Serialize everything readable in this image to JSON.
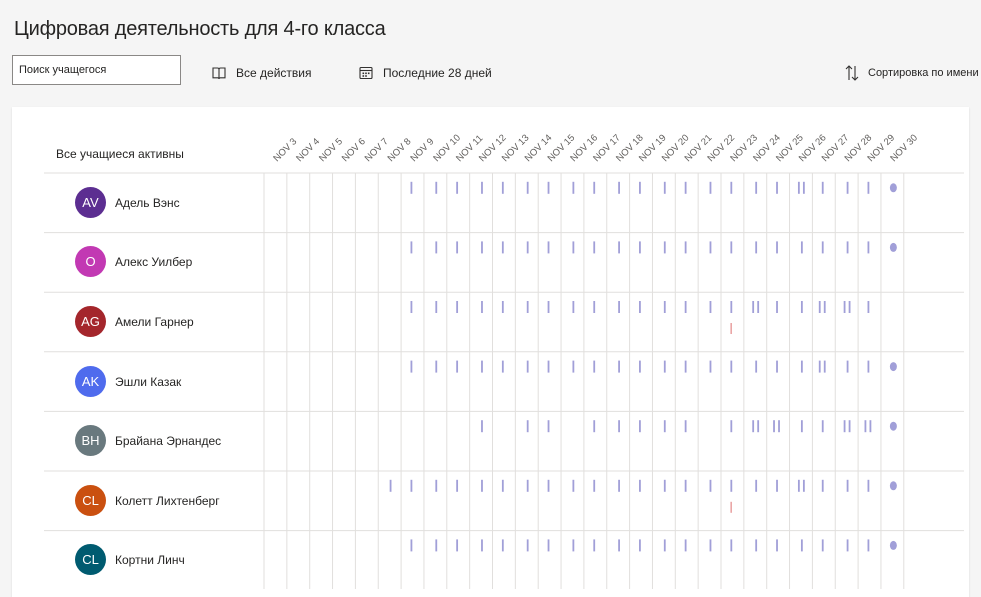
{
  "page_title": "Цифровая деятельность для 4-го класса",
  "search": {
    "placeholder": "Поиск учащегося"
  },
  "toolbar": {
    "activities_label": "Все действия",
    "activities_icon": "book-icon",
    "period_label": "Последние 28 дней",
    "period_icon": "calendar-icon",
    "sort_label": "Сортировка по имени",
    "sort_icon": "sort-icon"
  },
  "table": {
    "header_label": "Все учащиеся активны",
    "dates": [
      "NOV 3",
      "NOV 4",
      "NOV 5",
      "NOV 6",
      "NOV 7",
      "NOV 8",
      "NOV 9",
      "NOV 10",
      "NOV 11",
      "NOV 12",
      "NOV 13",
      "NOV 14",
      "NOV 15",
      "NOV 16",
      "NOV 17",
      "NOV 18",
      "NOV 19",
      "NOV 20",
      "NOV 21",
      "NOV 22",
      "NOV 23",
      "NOV 24",
      "NOV 25",
      "NOV 26",
      "NOV 27",
      "NOV 28",
      "NOV 29",
      "NOV 30"
    ]
  },
  "colors": {
    "activity": "#a19fd8",
    "alert": "#e8a0a0",
    "grid": "#e1dfdd"
  },
  "students": [
    {
      "name": "Адель Вэнс",
      "initials": "AV",
      "color": "#5c2e91",
      "activity": [
        0,
        0,
        0,
        0,
        0,
        0,
        1,
        1,
        1,
        1,
        1,
        1,
        1,
        1,
        1,
        1,
        1,
        1,
        1,
        1,
        1,
        1,
        1,
        2,
        1,
        1,
        1,
        3
      ]
    },
    {
      "name": "Алекс Уилбер",
      "initials": "О",
      "color": "#c239b3",
      "activity": [
        0,
        0,
        0,
        0,
        0,
        0,
        1,
        1,
        1,
        1,
        1,
        1,
        1,
        1,
        1,
        1,
        1,
        1,
        1,
        1,
        1,
        1,
        1,
        1,
        1,
        1,
        1,
        3
      ]
    },
    {
      "name": "Амели Гарнер",
      "initials": "AG",
      "color": "#a4262c",
      "activity": [
        0,
        0,
        0,
        0,
        0,
        0,
        1,
        1,
        1,
        1,
        1,
        1,
        1,
        1,
        1,
        1,
        1,
        1,
        1,
        1,
        4,
        2,
        1,
        1,
        2,
        2,
        1,
        0
      ]
    },
    {
      "name": "Эшли Казак",
      "initials": "AK",
      "color": "#4f6bed",
      "activity": [
        0,
        0,
        0,
        0,
        0,
        0,
        1,
        1,
        1,
        1,
        1,
        1,
        1,
        1,
        1,
        1,
        1,
        1,
        1,
        1,
        1,
        1,
        1,
        1,
        2,
        1,
        1,
        3
      ]
    },
    {
      "name": "Брайана Эрнандес",
      "initials": "BH",
      "color": "#69797e",
      "activity": [
        0,
        0,
        0,
        0,
        0,
        0,
        0,
        0,
        0,
        1,
        0,
        1,
        1,
        0,
        1,
        1,
        1,
        1,
        1,
        0,
        1,
        2,
        2,
        1,
        1,
        2,
        2,
        3
      ]
    },
    {
      "name": "Колетт Лихтенберг",
      "initials": "CL",
      "color": "#ca5010",
      "activity": [
        0,
        0,
        0,
        0,
        0,
        1,
        1,
        1,
        1,
        1,
        1,
        1,
        1,
        1,
        1,
        1,
        1,
        1,
        1,
        1,
        4,
        1,
        1,
        2,
        1,
        1,
        1,
        3
      ]
    },
    {
      "name": "Кортни Линч",
      "initials": "CL",
      "color": "#005b70",
      "activity": [
        0,
        0,
        0,
        0,
        0,
        0,
        1,
        1,
        1,
        1,
        1,
        1,
        1,
        1,
        1,
        1,
        1,
        1,
        1,
        1,
        1,
        1,
        1,
        1,
        1,
        1,
        1,
        3
      ]
    }
  ]
}
